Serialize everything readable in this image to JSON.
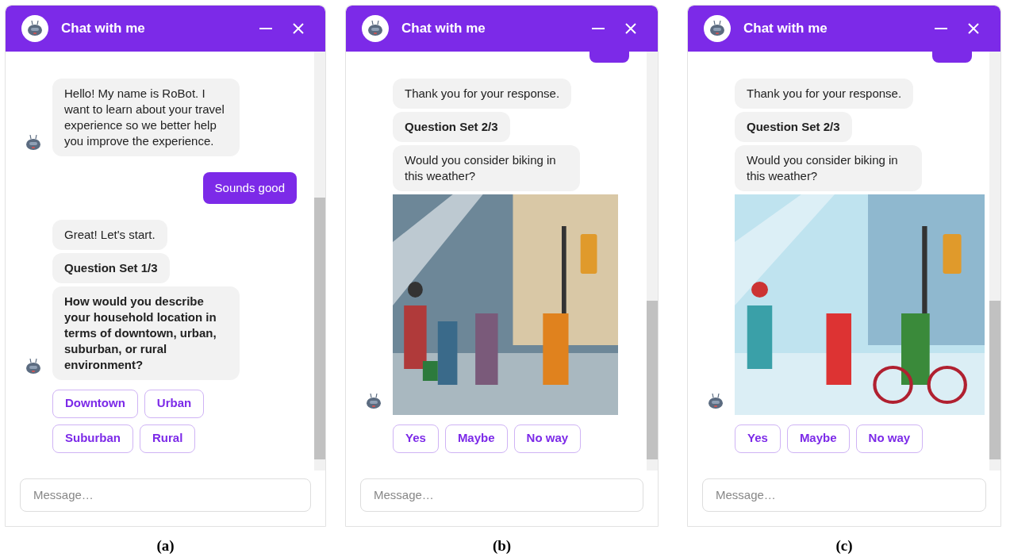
{
  "panels": [
    {
      "caption": "(a)",
      "header": {
        "title": "Chat with me"
      },
      "messages": [
        {
          "kind": "bot",
          "bubbles": [
            {
              "kind": "text",
              "text": "Hello! My name is RoBot. I want to learn about your travel experience so we better help you improve the experience.",
              "bold": false
            }
          ]
        },
        {
          "kind": "user",
          "text": "Sounds good"
        },
        {
          "kind": "bot",
          "bubbles": [
            {
              "kind": "text",
              "text": "Great! Let's start.",
              "bold": false
            },
            {
              "kind": "text",
              "text": "Question Set 1/3",
              "bold": true
            },
            {
              "kind": "text",
              "text": "How would you describe your household location in terms of downtown, urban, suburban, or rural environment?",
              "bold": true
            }
          ]
        }
      ],
      "choices": [
        "Downtown",
        "Urban",
        "Suburban",
        "Rural"
      ],
      "input": {
        "placeholder": "Message…"
      }
    },
    {
      "caption": "(b)",
      "header": {
        "title": "Chat with me"
      },
      "messages": [
        {
          "kind": "user"
        },
        {
          "kind": "bot",
          "bubbles": [
            {
              "kind": "text",
              "text": "Thank you for your response.",
              "bold": false
            },
            {
              "kind": "text",
              "text": "Question Set 2/3",
              "bold": true
            },
            {
              "kind": "text",
              "text": "Would you consider biking in this weather?",
              "bold": false
            },
            {
              "kind": "picture"
            }
          ]
        }
      ],
      "choices": [
        "Yes",
        "Maybe",
        "No way"
      ],
      "input": {
        "placeholder": "Message…"
      }
    },
    {
      "caption": "(c)",
      "header": {
        "title": "Chat with me"
      },
      "messages": [
        {
          "kind": "user"
        },
        {
          "kind": "bot",
          "bubbles": [
            {
              "kind": "text",
              "text": "Thank you for your response.",
              "bold": false
            },
            {
              "kind": "text",
              "text": "Question Set 2/3",
              "bold": true
            },
            {
              "kind": "text",
              "text": "Would you consider biking in this weather?",
              "bold": false
            },
            {
              "kind": "picture"
            }
          ]
        }
      ],
      "choices": [
        "Yes",
        "Maybe",
        "No way"
      ],
      "input": {
        "placeholder": "Message…"
      }
    }
  ]
}
